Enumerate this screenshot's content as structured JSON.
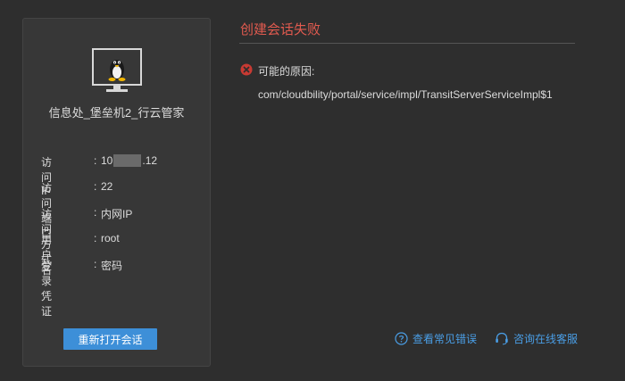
{
  "error": {
    "title": "创建会话失败",
    "reason_label": "可能的原因:",
    "reason_detail": "com/cloudbility/portal/service/impl/TransitServerServiceImpl$1"
  },
  "host": {
    "name": "信息处_堡垒机2_行云管家",
    "icon": "linux-tux-icon",
    "fields": [
      {
        "label": "访 问 IP",
        "value_prefix": "10",
        "value_suffix": ".12"
      },
      {
        "label": "访问端口",
        "value": "22"
      },
      {
        "label": "访问方式",
        "value": "内网IP"
      },
      {
        "label": "用 户 名",
        "value": "root"
      },
      {
        "label": "登录凭证",
        "value": "密码"
      }
    ]
  },
  "actions": {
    "reopen_label": "重新打开会话",
    "faq_label": "查看常见错误",
    "support_label": "咨询在线客服"
  },
  "colors": {
    "background": "#2e2e2e",
    "panel": "#373737",
    "error_red": "#e05a4f",
    "accent_blue": "#3d8fd8",
    "link_blue": "#4a9ee6"
  }
}
